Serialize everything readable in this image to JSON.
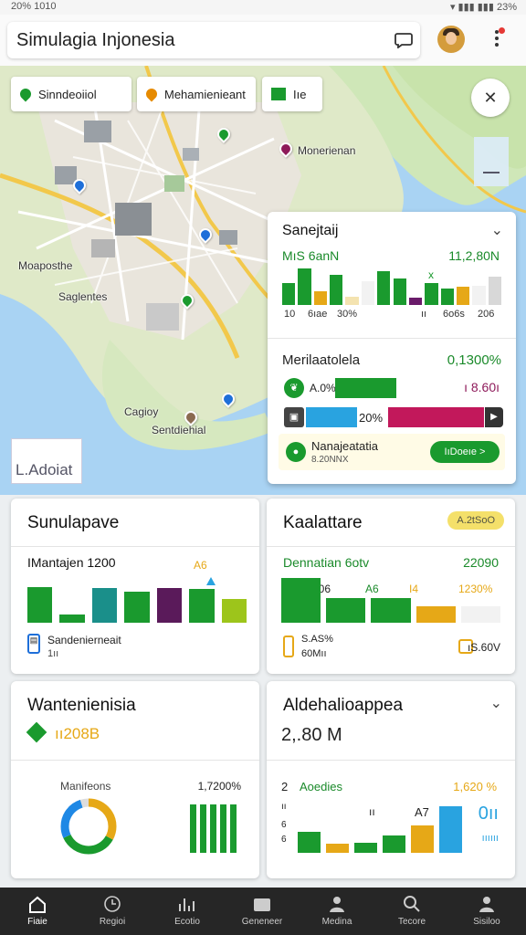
{
  "status": {
    "left": "20% 1010",
    "right": "23%"
  },
  "appbar": {
    "title": "Simulagia Injonesia",
    "chat_icon": "chat-bubble-icon",
    "avatar_icon": "user-avatar"
  },
  "map": {
    "chips": [
      {
        "label": "Sinndeoiiol",
        "icon": "map-pin-icon",
        "color": "#1a9a2e"
      },
      {
        "label": "Mehamienieant",
        "icon": "map-pin-icon",
        "color": "#e68a00"
      },
      {
        "label": "Iıe",
        "icon": "flag-icon",
        "color": "#1a9a2e"
      }
    ],
    "labels": [
      "Monerienan",
      "Moaposthe",
      "Saglentes",
      "Cagioy",
      "Sentdiehial"
    ],
    "attribution": "L.Adoiat",
    "compass_icon": "compass-icon"
  },
  "overlay": {
    "title": "Sanejtaij",
    "sub_left": "MıS 6anN",
    "sub_right": "11,2,80N",
    "mini_bars": [
      {
        "v": 0.55,
        "c": "#1a9a2e"
      },
      {
        "v": 0.9,
        "c": "#1a9a2e"
      },
      {
        "v": 0.35,
        "c": "#e6a817"
      },
      {
        "v": 0.75,
        "c": "#1a9a2e"
      },
      {
        "v": 0.2,
        "c": "#f4e3b0"
      },
      {
        "v": 0.6,
        "c": "#f2f2f2"
      },
      {
        "v": 0.85,
        "c": "#1a9a2e"
      },
      {
        "v": 0.65,
        "c": "#1a9a2e"
      },
      {
        "v": 0.18,
        "c": "#6a1b6a"
      },
      {
        "v": 0.55,
        "c": "#1a9a2e"
      },
      {
        "v": 0.4,
        "c": "#1a9a2e"
      },
      {
        "v": 0.45,
        "c": "#e6a817"
      },
      {
        "v": 0.48,
        "c": "#f2f2f2"
      },
      {
        "v": 0.7,
        "c": "#d8d8d8"
      }
    ],
    "foot_a": "10",
    "foot_b": "6ıae",
    "foot_c": "30%",
    "foot_d": "ıı",
    "foot_e": "6o6s",
    "foot_f": "206",
    "marker": "x",
    "section_title": "Merilaatolela",
    "section_value": "0,1300%",
    "row1_label": "A.0%",
    "row1_value": "ı 8.60ı",
    "row1_fill": 0.42,
    "row2_label": "20%",
    "row2_fill": 0.78,
    "notice_title": "Nanajeatatia",
    "notice_sub": "8.20NNX",
    "notice_button": "IıDoeıe >"
  },
  "card_sim": {
    "title": "Sunulapave",
    "sub": "IMantajen 1200",
    "sub_right": "A6",
    "bars": [
      {
        "v": 0.82,
        "c": "#1a9a2e"
      },
      {
        "v": 0.18,
        "c": "#1a9a2e"
      },
      {
        "v": 0.8,
        "c": "#1a8f8a"
      },
      {
        "v": 0.7,
        "c": "#1a9a2e"
      },
      {
        "v": 0.8,
        "c": "#5a1a5a"
      },
      {
        "v": 0.78,
        "c": "#1a9a2e"
      },
      {
        "v": 0.55,
        "c": "#9dc51b"
      }
    ],
    "legend_label": "Sandenierneait",
    "legend_sub": "1ıı"
  },
  "card_kal": {
    "title": "Kaalattare",
    "badge": "A.2tSoO",
    "sub_left": "Dennatian 6otv",
    "sub_right": "22090",
    "vals": [
      "906",
      "A6",
      "I4",
      "1230%"
    ],
    "bars": [
      {
        "v": 0.95,
        "c": "#1a9a2e"
      },
      {
        "v": 0.52,
        "c": "#1a9a2e"
      },
      {
        "v": 0.52,
        "c": "#1a9a2e"
      },
      {
        "v": 0.35,
        "c": "#e6a817"
      },
      {
        "v": 0.35,
        "c": "#f2f2f2"
      }
    ],
    "legend_label": "S.AS%",
    "legend_sub": "60Mıı",
    "legend_right": "ıS.60V"
  },
  "card_want": {
    "title": "Wantenienisia",
    "value": "ıı208B",
    "donut_label": "Manifeons",
    "donut_value": "1,7200%",
    "donut_parts": [
      0.33,
      0.35,
      0.27,
      0.05
    ],
    "donut_colors": [
      "#e6a817",
      "#1a9a2e",
      "#1e88e5",
      "#dddddd"
    ],
    "stripes": [
      0.95,
      0.95,
      0.95,
      0.95,
      0.95
    ]
  },
  "card_ald": {
    "title": "Aldehalioappea",
    "value": "2,.80 M",
    "sub_num": "2",
    "sub_label": "Aoedies",
    "sub_right": "1,620 %",
    "big_value": "0ıı",
    "big_sub": "ıııııı",
    "row_labels": [
      "ıı",
      "6",
      "6"
    ],
    "bar_labels": [
      "ıı",
      "A7"
    ],
    "bars": [
      {
        "v": 0.42,
        "c": "#1a9a2e"
      },
      {
        "v": 0.18,
        "c": "#e6a817"
      },
      {
        "v": 0.2,
        "c": "#1a9a2e"
      },
      {
        "v": 0.35,
        "c": "#1a9a2e"
      },
      {
        "v": 0.55,
        "c": "#e6a817"
      },
      {
        "v": 0.95,
        "c": "#29a3e0"
      }
    ]
  },
  "nav": [
    {
      "label": "Fiaie",
      "icon": "home-icon"
    },
    {
      "label": "Regioi",
      "icon": "clock-icon"
    },
    {
      "label": "Ecotio",
      "icon": "chart-icon"
    },
    {
      "label": "Geneneer",
      "icon": "folder-icon"
    },
    {
      "label": "Medina",
      "icon": "person-icon"
    },
    {
      "label": "Tecore",
      "icon": "search-icon"
    },
    {
      "label": "Sisiloo",
      "icon": "profile-icon"
    }
  ]
}
